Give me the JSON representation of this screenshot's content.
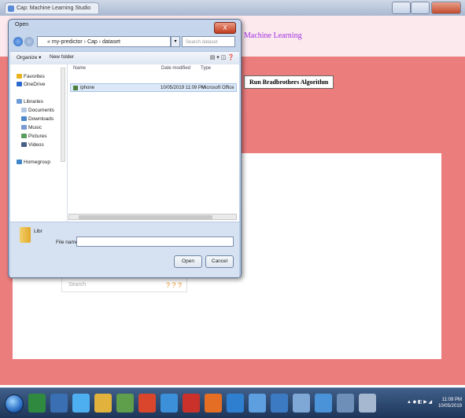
{
  "browser": {
    "tab_title": "Cap: Machine Learning Studio"
  },
  "page": {
    "heading": "Machine Learning",
    "run_button_label": "Run Bradbrothers Algorithm",
    "search_placeholder": "Search",
    "search_icons": "? ? ?"
  },
  "dialog": {
    "title": "Open",
    "close_label": "X",
    "address_path": "« my-predictor › Cap › dataset",
    "search_placeholder": "Search dataset",
    "toolbar": {
      "organize": "Organize ▾",
      "new_folder": "New folder"
    },
    "nav_items": [
      {
        "label": "Favorites",
        "icon": "star-icon",
        "color": "#e8b21e"
      },
      {
        "label": "OneDrive",
        "icon": "cloud-icon",
        "color": "#2a6ad0"
      },
      {
        "label": "Libraries",
        "icon": "library-icon",
        "color": "#6a9bd6"
      },
      {
        "label": "Documents",
        "icon": "document-icon",
        "color": "#b4c7de"
      },
      {
        "label": "Downloads",
        "icon": "download-icon",
        "color": "#4e86cc"
      },
      {
        "label": "Music",
        "icon": "music-icon",
        "color": "#7a9bd2"
      },
      {
        "label": "Pictures",
        "icon": "picture-icon",
        "color": "#5c9c5e"
      },
      {
        "label": "Videos",
        "icon": "video-icon",
        "color": "#4b5d84"
      },
      {
        "label": "Homegroup",
        "icon": "homegroup-icon",
        "color": "#3f86c9"
      }
    ],
    "columns": [
      "Name",
      "Date modified",
      "Type"
    ],
    "files": [
      {
        "name": "iphone",
        "date": "10/05/2019 11:09 PM",
        "type": "Microsoft Office"
      }
    ],
    "folder": "Libr",
    "filename_label": "File name:",
    "filename_value": "",
    "open_button": "Open",
    "cancel_button": "Cancel"
  },
  "taskbar": {
    "clock_time": "11:09 PM",
    "clock_date": "10/05/2019"
  }
}
